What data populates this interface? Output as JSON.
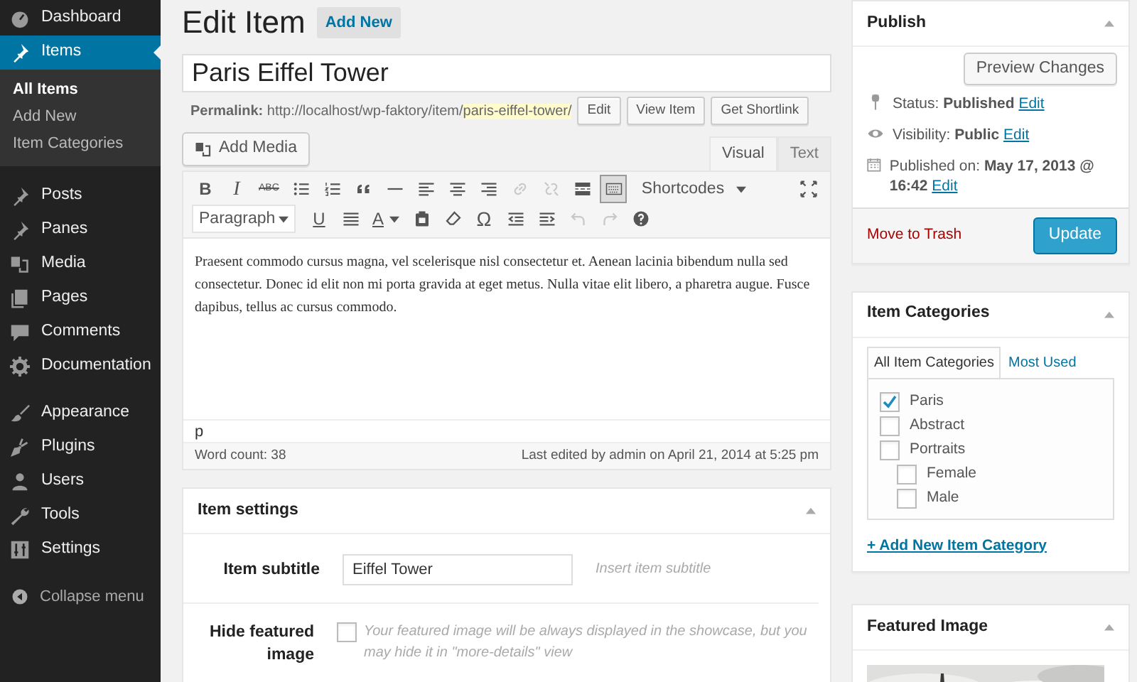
{
  "sidebar": {
    "groups": [
      [
        {
          "label": "Dashboard",
          "selected": false
        },
        {
          "label": "Items",
          "selected": true,
          "submenu": [
            {
              "label": "All Items",
              "selected": true
            },
            {
              "label": "Add New",
              "selected": false
            },
            {
              "label": "Item Categories",
              "selected": false
            }
          ]
        }
      ],
      [
        {
          "label": "Posts",
          "selected": false
        },
        {
          "label": "Panes",
          "selected": false
        },
        {
          "label": "Media",
          "selected": false
        },
        {
          "label": "Pages",
          "selected": false
        },
        {
          "label": "Comments",
          "selected": false
        },
        {
          "label": "Documentation",
          "selected": false
        }
      ],
      [
        {
          "label": "Appearance",
          "selected": false
        },
        {
          "label": "Plugins",
          "selected": false
        },
        {
          "label": "Users",
          "selected": false
        },
        {
          "label": "Tools",
          "selected": false
        },
        {
          "label": "Settings",
          "selected": false
        }
      ]
    ],
    "collapse": "Collapse menu"
  },
  "page_title": "Edit Item",
  "add_new": "Add New",
  "title_field": {
    "value": "Paris Eiffel Tower"
  },
  "permalink": {
    "label": "Permalink:",
    "base": "http://localhost/wp-faktory/item/",
    "slug": "paris-eiffel-tower/",
    "buttons": [
      "Edit",
      "View Item",
      "Get Shortlink"
    ]
  },
  "add_media": "Add Media",
  "editor_tabs": [
    {
      "label": "Visual",
      "selected": true
    },
    {
      "label": "Text",
      "selected": false
    }
  ],
  "toolbar": {
    "row_1": [
      {
        "kind": "bold",
        "text": "B",
        "disabled": false,
        "on": false
      },
      {
        "kind": "italic",
        "text": "I",
        "disabled": false,
        "on": false
      },
      {
        "kind": "strike",
        "text": "ABC",
        "disabled": false,
        "on": false
      },
      {
        "kind": "icon",
        "disabled": false,
        "on": false
      },
      {
        "kind": "icon",
        "disabled": false,
        "on": false
      },
      {
        "kind": "icon",
        "disabled": false,
        "on": false
      },
      {
        "kind": "icon",
        "disabled": false,
        "on": false
      },
      {
        "kind": "icon",
        "disabled": false,
        "on": false
      },
      {
        "kind": "icon",
        "disabled": false,
        "on": false
      },
      {
        "kind": "icon",
        "disabled": false,
        "on": false
      },
      {
        "kind": "icon",
        "disabled": true,
        "on": false
      },
      {
        "kind": "icon",
        "disabled": true,
        "on": false
      },
      {
        "kind": "icon",
        "disabled": false,
        "on": false
      },
      {
        "kind": "icon",
        "disabled": false,
        "on": true
      },
      {
        "kind": "dropdown",
        "text": "Shortcodes",
        "disabled": false,
        "on": false
      },
      {
        "kind": "icon",
        "disabled": false,
        "on": false
      }
    ],
    "row_2": [
      {
        "kind": "select",
        "text": "Paragraph",
        "disabled": false,
        "on": false
      },
      {
        "kind": "underline",
        "text": "U",
        "disabled": false,
        "on": false
      },
      {
        "kind": "icon",
        "disabled": false,
        "on": false
      },
      {
        "kind": "color",
        "text": "A",
        "disabled": false,
        "on": false
      },
      {
        "kind": "icon",
        "disabled": false,
        "on": false
      },
      {
        "kind": "icon",
        "disabled": false,
        "on": false
      },
      {
        "kind": "glyph",
        "text": "Ω",
        "disabled": false,
        "on": false
      },
      {
        "kind": "icon",
        "disabled": false,
        "on": false
      },
      {
        "kind": "icon",
        "disabled": false,
        "on": false
      },
      {
        "kind": "icon",
        "disabled": true,
        "on": false
      },
      {
        "kind": "icon",
        "disabled": true,
        "on": false
      },
      {
        "kind": "icon",
        "disabled": false,
        "on": false
      }
    ]
  },
  "content": "Praesent commodo cursus magna, vel scelerisque nisl consectetur et. Aenean lacinia bibendum nulla sed consectetur. Donec id elit non mi porta gravida at eget metus. Nulla vitae elit libero, a pharetra augue. Fusce dapibus, tellus ac cursus commodo.",
  "path": "p",
  "word_count": "Word count: 38",
  "last_edited": "Last edited by admin on April 21, 2014 at 5:25 pm",
  "item_settings": {
    "title": "Item settings",
    "subtitle": {
      "label": "Item subtitle",
      "value": "Eiffel Tower",
      "hint": "Insert item subtitle"
    },
    "hide_image": {
      "label": "Hide featured image",
      "checked": false,
      "description": "Your featured image will be always displayed in the showcase, but you may hide it in \"more-details\" view"
    }
  },
  "publish": {
    "title": "Publish",
    "preview": "Preview Changes",
    "rows": [
      {
        "label": "Status:",
        "value": "Published",
        "link": "Edit"
      },
      {
        "label": "Visibility:",
        "value": "Public",
        "link": "Edit"
      },
      {
        "label": "Published on:",
        "value": "May 17, 2013 @ 16:42",
        "link": "Edit"
      }
    ],
    "trash": "Move to Trash",
    "update": "Update"
  },
  "categories": {
    "title": "Item Categories",
    "tabs": [
      {
        "label": "All Item Categories",
        "selected": true
      },
      {
        "label": "Most Used",
        "selected": false
      }
    ],
    "items": [
      {
        "label": "Paris",
        "checked": true
      },
      {
        "label": "Abstract",
        "checked": false
      },
      {
        "label": "Portraits",
        "checked": false,
        "children": [
          {
            "label": "Female",
            "checked": false
          },
          {
            "label": "Male",
            "checked": false
          }
        ]
      }
    ],
    "add_link": "+ Add New Item Category"
  },
  "featured_image": {
    "title": "Featured Image"
  }
}
